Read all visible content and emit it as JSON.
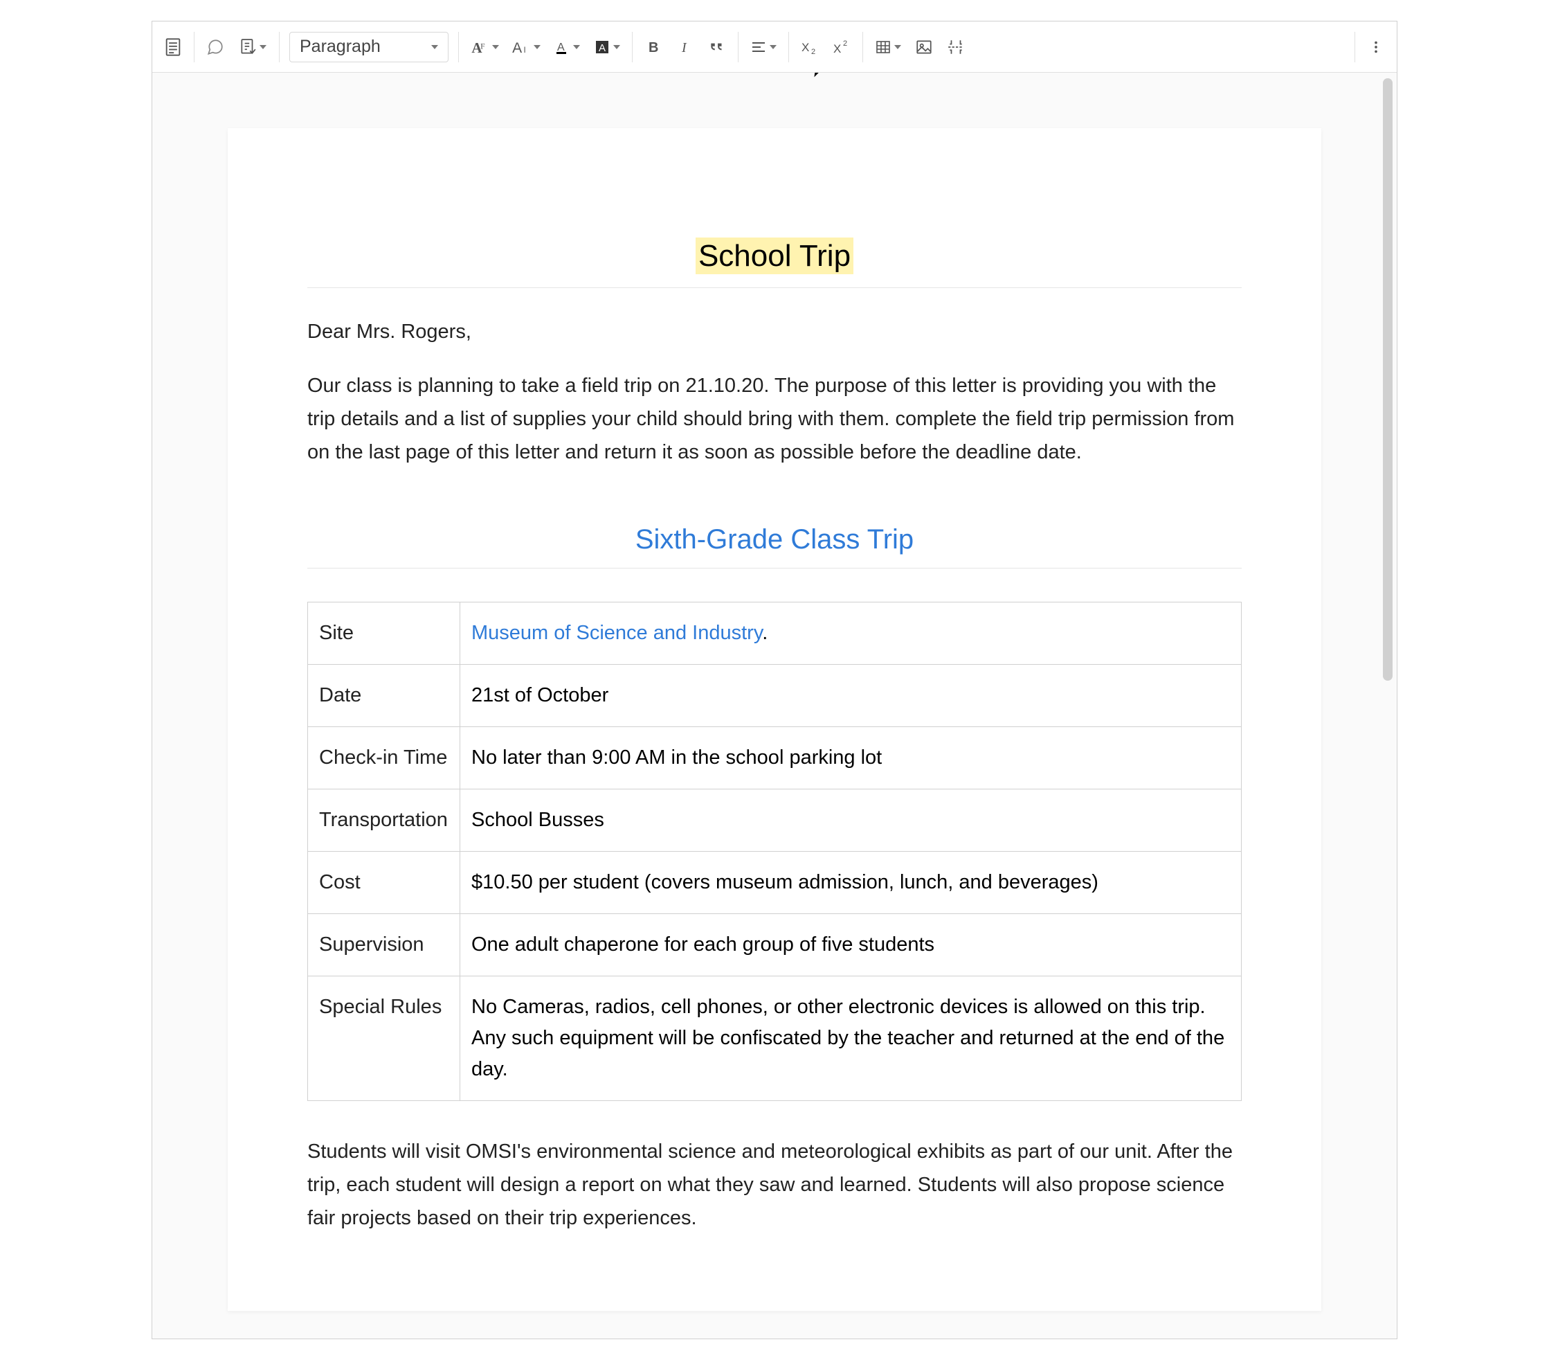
{
  "toolbar": {
    "styleSelect": "Paragraph"
  },
  "document": {
    "title": "School Trip",
    "salutation": "Dear Mrs. Rogers,",
    "intro": "Our class is planning to take a field trip on 21.10.20. The purpose of this letter is providing you with the trip details and a list of supplies your child should bring with them. complete the field trip permission from on the last page of this letter and return it as soon as possible before the deadline date.",
    "sectionHeading": "Sixth-Grade Class Trip",
    "table": {
      "rows": [
        {
          "k": "Site",
          "link": "Museum of Science and Industry",
          "after": "."
        },
        {
          "k": "Date",
          "v": "21st of October"
        },
        {
          "k": "Check-in Time",
          "v": "No later than 9:00 AM in the school parking lot"
        },
        {
          "k": "Transportation",
          "v": "School Busses"
        },
        {
          "k": "Cost",
          "v": "$10.50 per student (covers museum admission, lunch, and beverages)"
        },
        {
          "k": "Supervision",
          "v": "One adult chaperone for each group of five students"
        },
        {
          "k": "Special Rules",
          "v": "No Cameras, radios, cell phones, or other electronic devices is allowed on this trip. Any such equipment will be confiscated by the teacher and returned at the end of the day."
        }
      ]
    },
    "followup": "Students will visit OMSI's environmental science and meteorological exhibits as part of our unit. After the trip, each student will design a report on what they saw and learned. Students will also propose science fair projects based on their trip experiences."
  }
}
